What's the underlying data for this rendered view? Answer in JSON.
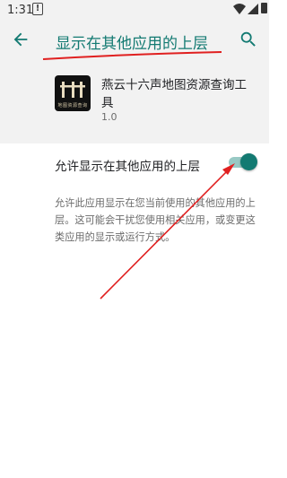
{
  "status_bar": {
    "time": "1:31",
    "alert_glyph": "!",
    "icons": [
      "alert-icon",
      "wifi-icon",
      "signal-icon",
      "battery-icon"
    ]
  },
  "app_bar": {
    "title": "显示在其他应用的上层",
    "back_icon": "arrow-back-icon",
    "search_icon": "search-icon"
  },
  "app_info": {
    "name": "燕云十六声地图资源查询工具",
    "version": "1.0",
    "logo_caption": "地图资源查询"
  },
  "setting": {
    "label": "允许显示在其他应用的上层",
    "enabled": true,
    "description": "允许此应用显示在您当前使用的其他应用的上层。这可能会干扰您使用相关应用，或变更这类应用的显示或运行方式。"
  },
  "colors": {
    "accent": "#137a72",
    "toggle_track": "#98c9c4",
    "header_bg": "#f2f2f2",
    "annotation": "#e02020"
  }
}
